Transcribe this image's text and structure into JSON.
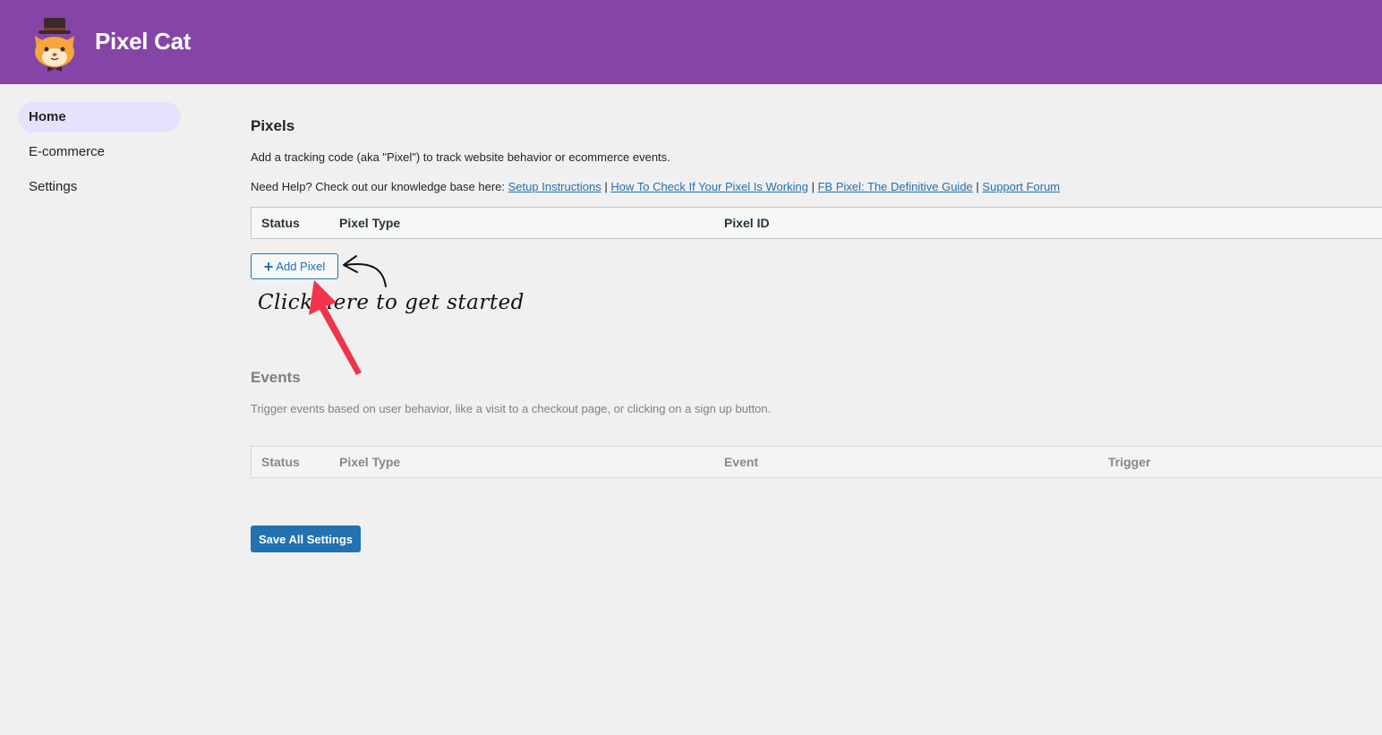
{
  "app": {
    "title": "Pixel Cat",
    "brand_color": "#8545a6",
    "logo_icon": "cat-top-hat-logo"
  },
  "sidebar": {
    "items": [
      {
        "label": "Home",
        "active": true
      },
      {
        "label": "E-commerce",
        "active": false
      },
      {
        "label": "Settings",
        "active": false
      }
    ]
  },
  "pixels": {
    "title": "Pixels",
    "description": "Add a tracking code (aka \"Pixel\") to track website behavior or ecommerce events.",
    "help_prefix": "Need Help? Check out our knowledge base here:",
    "separator": "|",
    "help_links": [
      "Setup Instructions",
      "How To Check If Your Pixel Is Working",
      "FB Pixel: The Definitive Guide",
      "Support Forum"
    ],
    "columns": [
      "Status",
      "Pixel Type",
      "Pixel ID"
    ],
    "add_button": "Add Pixel",
    "annotation": "Click here to get started"
  },
  "events": {
    "title": "Events",
    "description": "Trigger events based on user behavior, like a visit to a checkout page, or clicking on a sign up button.",
    "columns": [
      "Status",
      "Pixel Type",
      "Event",
      "Trigger"
    ]
  },
  "save_button": "Save All Settings",
  "colors": {
    "link": "#2271b1",
    "button": "#2271b1",
    "arrow": "#f0344b",
    "nav_active": "#e7e2fb"
  }
}
